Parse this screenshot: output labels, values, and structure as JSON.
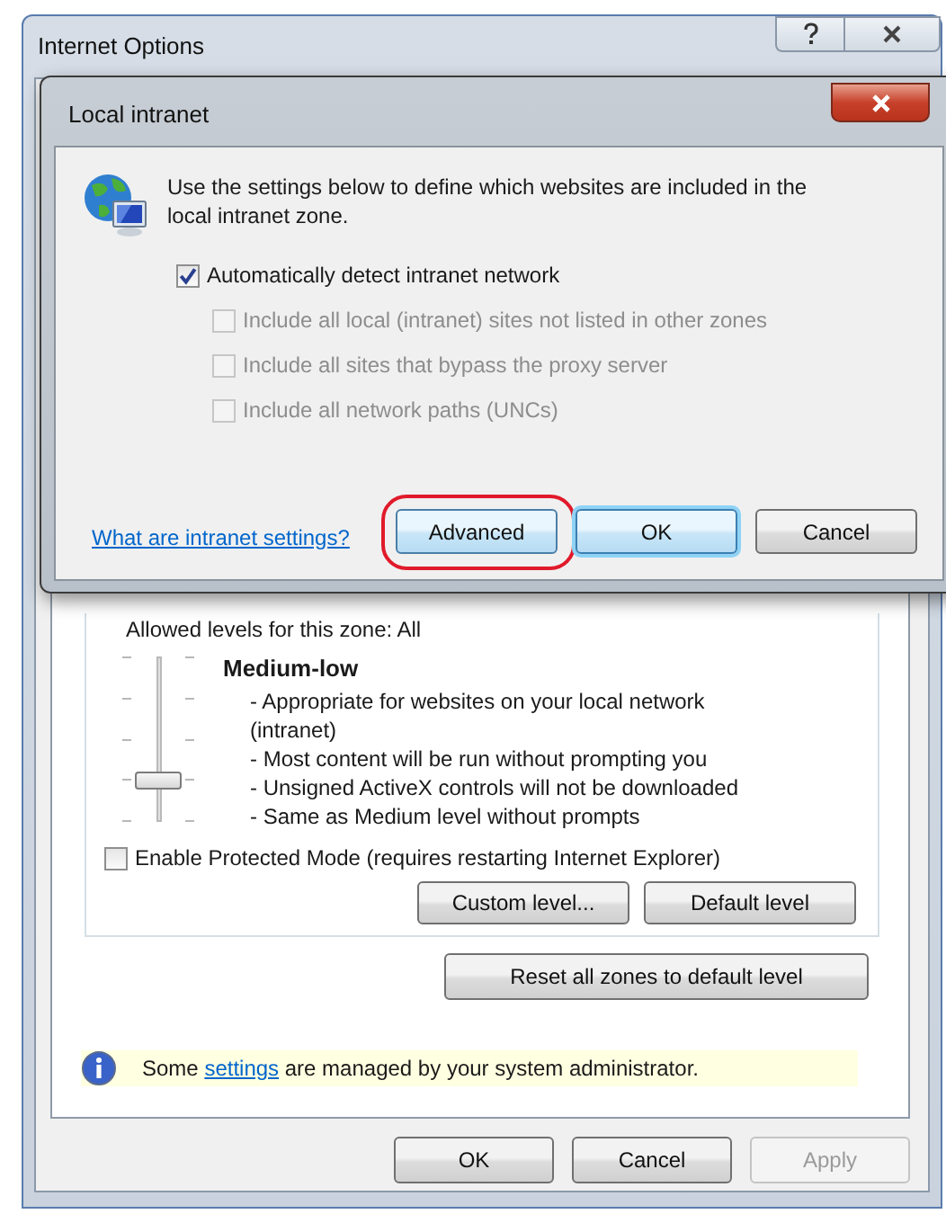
{
  "window": {
    "title": "Internet Options"
  },
  "security": {
    "allowed_label": "Allowed levels for this zone: All",
    "slider": {
      "level": 0.25
    },
    "level_name": "Medium-low",
    "description": [
      "- Appropriate for websites on your local network (intranet)",
      "- Most content will be run without prompting you",
      "- Unsigned ActiveX controls will not be downloaded",
      "- Same as Medium level without prompts"
    ],
    "protected_mode": {
      "label": "Enable Protected Mode (requires restarting Internet Explorer)",
      "checked": false
    },
    "buttons": [
      {
        "label": "Custom level..."
      },
      {
        "label": "Default level"
      }
    ]
  },
  "reset_button": {
    "label": "Reset all zones to default level"
  },
  "info_bar": {
    "before": "Some",
    "link": "settings",
    "after": "are managed by your system administrator."
  },
  "buttons": [
    {
      "label": "OK",
      "disabled": false
    },
    {
      "label": "Cancel",
      "disabled": false
    },
    {
      "label": "Apply",
      "disabled": true
    }
  ],
  "dialog": {
    "title": "Local intranet",
    "intro": "Use the settings below to define which websites are included in the local intranet zone.",
    "options": [
      {
        "label": "Automatically detect intranet network",
        "checked": true,
        "disabled": false,
        "children": [
          {
            "label": "Include all local (intranet) sites not listed in other zones",
            "checked": false,
            "disabled": true
          },
          {
            "label": "Include all sites that bypass the proxy server",
            "checked": false,
            "disabled": true
          },
          {
            "label": "Include all network paths (UNCs)",
            "checked": false,
            "disabled": true
          }
        ]
      }
    ],
    "help_link": "What are intranet settings?",
    "buttons": [
      {
        "label": "Advanced",
        "highlighted": true,
        "default": false
      },
      {
        "label": "OK",
        "highlighted": false,
        "default": true
      },
      {
        "label": "Cancel",
        "highlighted": false,
        "default": false
      }
    ]
  }
}
